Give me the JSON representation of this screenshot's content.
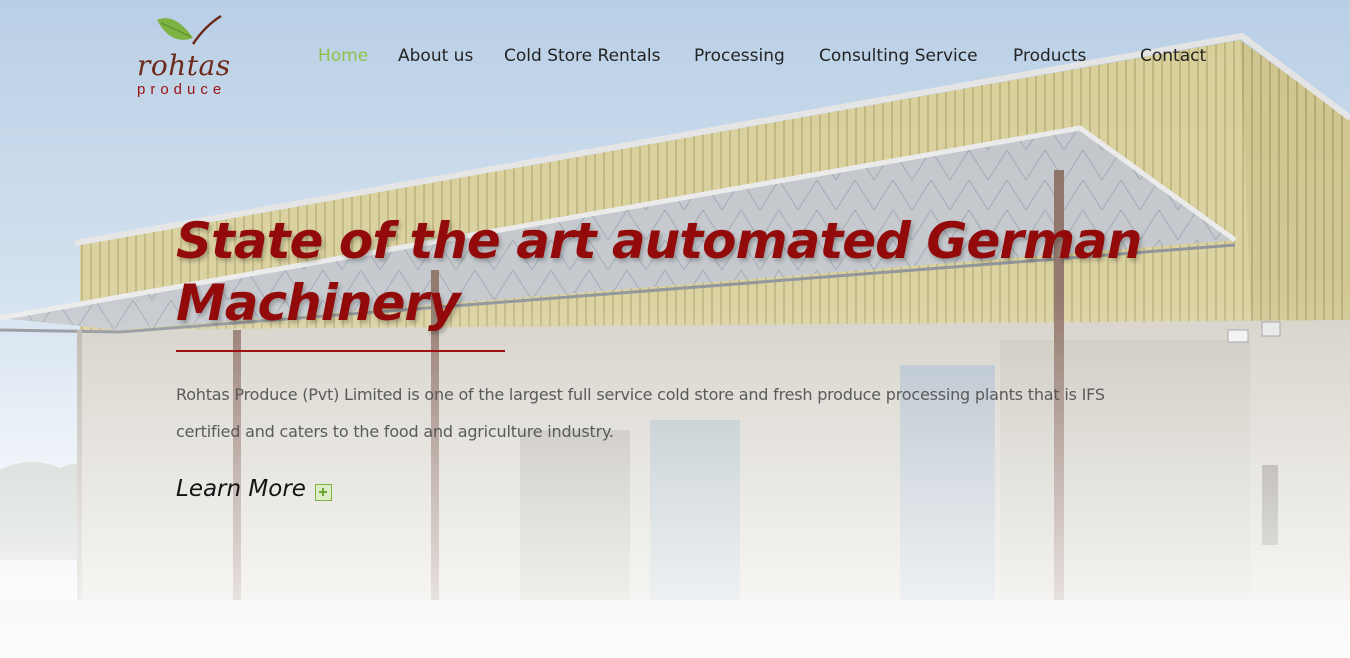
{
  "brand": {
    "name": "rohtas",
    "tagline": "produce",
    "leaf_color": "#7cb342",
    "word_color": "#6b2a1a",
    "tagline_color": "#9a1010"
  },
  "nav": {
    "items": [
      {
        "label": "Home",
        "active": true
      },
      {
        "label": "About us",
        "active": false
      },
      {
        "label": "Cold Store Rentals",
        "active": false
      },
      {
        "label": "Processing",
        "active": false
      },
      {
        "label": "Consulting Service",
        "active": false
      },
      {
        "label": "Products",
        "active": false
      },
      {
        "label": "Contact",
        "active": false
      }
    ],
    "active_color": "#8bc34a"
  },
  "hero": {
    "headline": "State of the art automated German Machinery",
    "description": "Rohtas Produce (Pvt) Limited is one of the largest full service cold store and fresh produce processing plants that is IFS certified and caters to the food and agriculture industry.",
    "cta_label": "Learn More",
    "cta_icon": "plus-square-icon",
    "headline_color": "#920a0a",
    "background": "warehouse-photo"
  }
}
